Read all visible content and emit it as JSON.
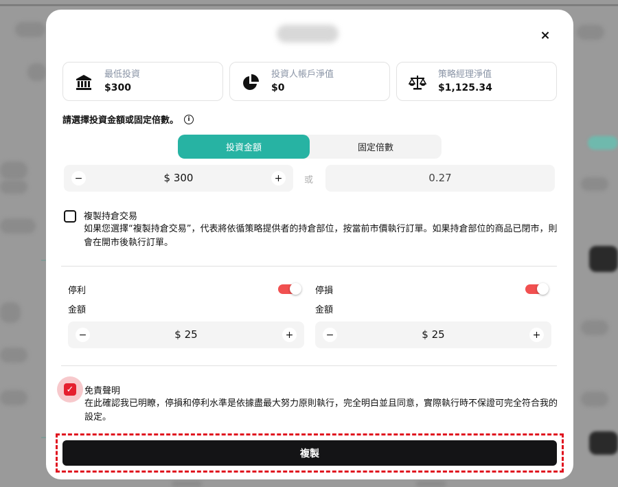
{
  "modal": {
    "close_label": "×"
  },
  "stats": [
    {
      "icon": "bank-icon",
      "label": "最低投資",
      "value": "$300"
    },
    {
      "icon": "pie-chart-icon",
      "label": "投資人帳戶淨值",
      "value": "$0"
    },
    {
      "icon": "scale-icon",
      "label": "策略經理淨值",
      "value": "$1,125.34"
    }
  ],
  "prompt": {
    "text": "請選擇投資金額或固定倍數。",
    "info": "i"
  },
  "segment": {
    "options": [
      "投資金額",
      "固定倍數"
    ],
    "selected": "投資金額"
  },
  "amount": {
    "minus": "−",
    "plus": "+",
    "value": "$ 300"
  },
  "or_label": "或",
  "ratio": {
    "value": "0.27"
  },
  "copy_positions": {
    "checked": false,
    "title": "複製持倉交易",
    "description": "如果您選擇“複製持倉交易”，代表將依循策略提供者的持倉部位，按當前市價執行訂單。如果持倉部位的商品已閉市，則會在開市後執行訂單。"
  },
  "take_profit": {
    "name": "停利",
    "amount_label": "金額",
    "enabled": true,
    "minus": "−",
    "plus": "+",
    "value": "$ 25"
  },
  "stop_loss": {
    "name": "停損",
    "amount_label": "金額",
    "enabled": true,
    "minus": "−",
    "plus": "+",
    "value": "$ 25"
  },
  "disclaimer": {
    "checked": true,
    "check_glyph": "✓",
    "title": "免責聲明",
    "description": "在此確認我已明瞭，停損和停利水準是依據盡最大努力原則執行，完全明白並且同意，實際執行時不保證可完全符合我的設定。"
  },
  "copy_button": {
    "label": "複製"
  },
  "colors": {
    "accent": "#27b3a3",
    "toggle": "#f15050",
    "check": "#e5202f",
    "highlight": "#e0121f",
    "button": "#141416"
  }
}
